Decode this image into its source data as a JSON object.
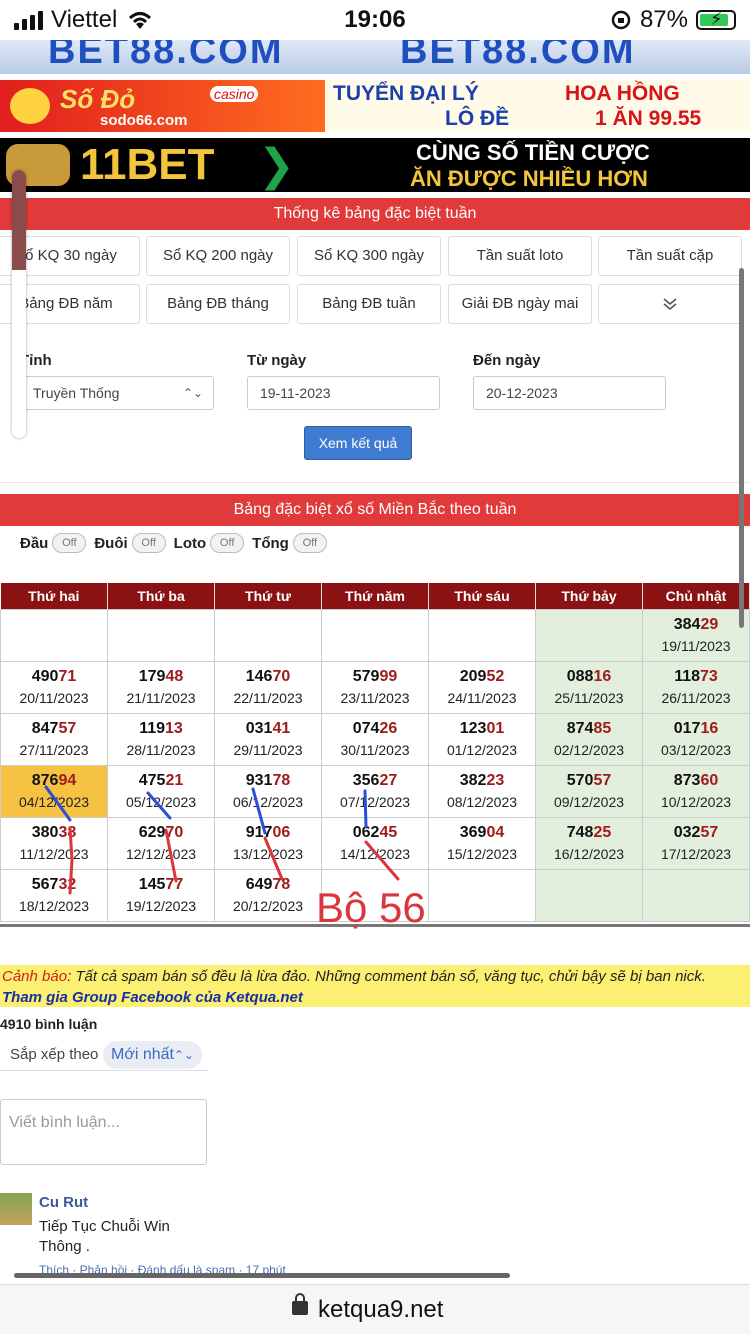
{
  "status": {
    "carrier": "Viettel",
    "time": "19:06",
    "battery": "87%"
  },
  "ads": {
    "bet88_left": "BET88.COM",
    "bet88_right": "BET88.COM",
    "sodo_brand": "Số Đỏ",
    "sodo_casino": "casino",
    "sodo_url": "sodo66.com",
    "sodo_line1a": "TUYỂN ĐẠI LÝ",
    "sodo_line1b": "HOA HỒNG",
    "sodo_line2a": "LÔ ĐỀ",
    "sodo_line2b": "1 ĂN 99.55",
    "bet11_brand": "11BET",
    "bet11_line1": "CÙNG SỐ TIỀN CƯỢC",
    "bet11_line2": "ĂN ĐƯỢC NHIỀU HƠN"
  },
  "stats_header": "Thống kê bảng đặc biệt tuần",
  "filter_row1": [
    "Sổ KQ 30 ngày",
    "Sổ KQ 200 ngày",
    "Sổ KQ 300 ngày",
    "Tần suất loto",
    "Tần suất cặp"
  ],
  "filter_row2": [
    "Bảng ĐB năm",
    "Bảng ĐB tháng",
    "Bảng ĐB tuần",
    "Giải ĐB ngày mai"
  ],
  "form": {
    "province_label": "Tỉnh",
    "province_value": "Truyền Thống",
    "from_label": "Từ ngày",
    "from_value": "19-11-2023",
    "to_label": "Đến ngày",
    "to_value": "20-12-2023",
    "submit": "Xem kết quả"
  },
  "table_header": "Bảng đặc biệt xổ số Miền Bắc theo tuần",
  "toggles": [
    {
      "label": "Đầu",
      "state": "Off"
    },
    {
      "label": "Đuôi",
      "state": "Off"
    },
    {
      "label": "Loto",
      "state": "Off"
    },
    {
      "label": "Tổng",
      "state": "Off"
    }
  ],
  "weekdays": [
    "Thứ hai",
    "Thứ ba",
    "Thứ tư",
    "Thứ năm",
    "Thứ sáu",
    "Thứ bảy",
    "Chủ nhật"
  ],
  "weeks": [
    [
      null,
      null,
      null,
      null,
      null,
      null,
      {
        "h": "384",
        "t": "29",
        "d": "19/11/2023"
      }
    ],
    [
      {
        "h": "490",
        "t": "71",
        "d": "20/11/2023"
      },
      {
        "h": "179",
        "t": "48",
        "d": "21/11/2023"
      },
      {
        "h": "146",
        "t": "70",
        "d": "22/11/2023"
      },
      {
        "h": "579",
        "t": "99",
        "d": "23/11/2023"
      },
      {
        "h": "209",
        "t": "52",
        "d": "24/11/2023"
      },
      {
        "h": "088",
        "t": "16",
        "d": "25/11/2023"
      },
      {
        "h": "118",
        "t": "73",
        "d": "26/11/2023"
      }
    ],
    [
      {
        "h": "847",
        "t": "57",
        "d": "27/11/2023"
      },
      {
        "h": "119",
        "t": "13",
        "d": "28/11/2023"
      },
      {
        "h": "031",
        "t": "41",
        "d": "29/11/2023"
      },
      {
        "h": "074",
        "t": "26",
        "d": "30/11/2023"
      },
      {
        "h": "123",
        "t": "01",
        "d": "01/12/2023"
      },
      {
        "h": "874",
        "t": "85",
        "d": "02/12/2023"
      },
      {
        "h": "017",
        "t": "16",
        "d": "03/12/2023"
      }
    ],
    [
      {
        "h": "876",
        "t": "94",
        "d": "04/12/2023",
        "hl": true
      },
      {
        "h": "475",
        "t": "21",
        "d": "05/12/2023"
      },
      {
        "h": "931",
        "t": "78",
        "d": "06/12/2023"
      },
      {
        "h": "356",
        "t": "27",
        "d": "07/12/2023"
      },
      {
        "h": "382",
        "t": "23",
        "d": "08/12/2023"
      },
      {
        "h": "570",
        "t": "57",
        "d": "09/12/2023"
      },
      {
        "h": "873",
        "t": "60",
        "d": "10/12/2023"
      }
    ],
    [
      {
        "h": "380",
        "t": "38",
        "d": "11/12/2023"
      },
      {
        "h": "629",
        "t": "70",
        "d": "12/12/2023"
      },
      {
        "h": "917",
        "t": "06",
        "d": "13/12/2023"
      },
      {
        "h": "062",
        "t": "45",
        "d": "14/12/2023"
      },
      {
        "h": "369",
        "t": "04",
        "d": "15/12/2023"
      },
      {
        "h": "748",
        "t": "25",
        "d": "16/12/2023"
      },
      {
        "h": "032",
        "t": "57",
        "d": "17/12/2023"
      }
    ],
    [
      {
        "h": "567",
        "t": "32",
        "d": "18/12/2023"
      },
      {
        "h": "145",
        "t": "77",
        "d": "19/12/2023"
      },
      {
        "h": "649",
        "t": "78",
        "d": "20/12/2023"
      },
      null,
      null,
      null,
      null
    ]
  ],
  "annotation_text": "Bộ 56",
  "warning": {
    "label": "Cảnh báo",
    "text": ": Tất cả spam bán số đều là lừa đảo. Những comment bán số, văng tục, chửi bậy sẽ bị ban nick.",
    "link": "Tham gia Group Facebook của Ketqua.net"
  },
  "comments": {
    "count": "4910 bình luận",
    "sort_label": "Sắp xếp theo",
    "sort_value": "Mới nhất",
    "placeholder": "Viết bình luận...",
    "first": {
      "name": "Cu Rut",
      "text": "Tiếp Tục Chuỗi Win Thông .",
      "actions": "Thích · Phản hồi · Đánh dấu là spam · 17 phút"
    }
  },
  "url": "ketqua9.net",
  "colors": {
    "accent_red": "#e03a3a",
    "table_header": "#8b1212",
    "weekend": "#e3efdd",
    "highlight": "#f5c242",
    "tail": "#a01c1c"
  },
  "icons": {
    "signal": "signal-icon",
    "wifi": "wifi-icon",
    "lock": "lock-icon",
    "battery": "battery-icon",
    "expand": "chevron-double-down-icon"
  }
}
